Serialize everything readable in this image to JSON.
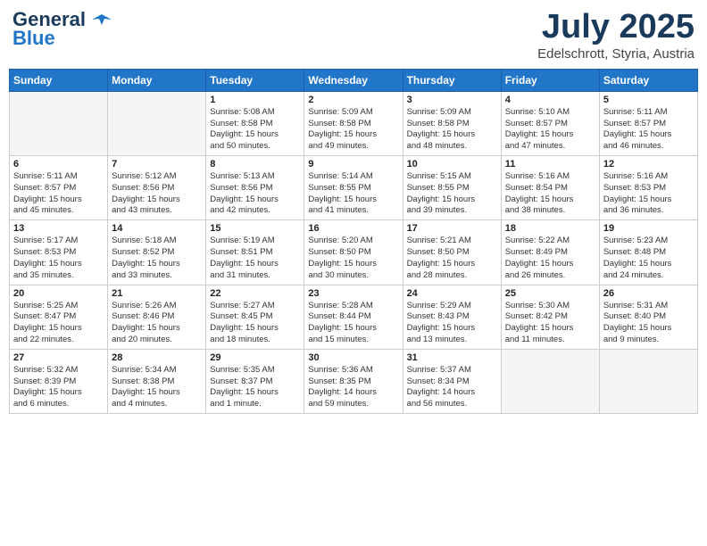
{
  "header": {
    "logo_line1": "General",
    "logo_line2": "Blue",
    "month": "July 2025",
    "location": "Edelschrott, Styria, Austria"
  },
  "days_of_week": [
    "Sunday",
    "Monday",
    "Tuesday",
    "Wednesday",
    "Thursday",
    "Friday",
    "Saturday"
  ],
  "weeks": [
    [
      {
        "day": "",
        "info": ""
      },
      {
        "day": "",
        "info": ""
      },
      {
        "day": "1",
        "info": "Sunrise: 5:08 AM\nSunset: 8:58 PM\nDaylight: 15 hours\nand 50 minutes."
      },
      {
        "day": "2",
        "info": "Sunrise: 5:09 AM\nSunset: 8:58 PM\nDaylight: 15 hours\nand 49 minutes."
      },
      {
        "day": "3",
        "info": "Sunrise: 5:09 AM\nSunset: 8:58 PM\nDaylight: 15 hours\nand 48 minutes."
      },
      {
        "day": "4",
        "info": "Sunrise: 5:10 AM\nSunset: 8:57 PM\nDaylight: 15 hours\nand 47 minutes."
      },
      {
        "day": "5",
        "info": "Sunrise: 5:11 AM\nSunset: 8:57 PM\nDaylight: 15 hours\nand 46 minutes."
      }
    ],
    [
      {
        "day": "6",
        "info": "Sunrise: 5:11 AM\nSunset: 8:57 PM\nDaylight: 15 hours\nand 45 minutes."
      },
      {
        "day": "7",
        "info": "Sunrise: 5:12 AM\nSunset: 8:56 PM\nDaylight: 15 hours\nand 43 minutes."
      },
      {
        "day": "8",
        "info": "Sunrise: 5:13 AM\nSunset: 8:56 PM\nDaylight: 15 hours\nand 42 minutes."
      },
      {
        "day": "9",
        "info": "Sunrise: 5:14 AM\nSunset: 8:55 PM\nDaylight: 15 hours\nand 41 minutes."
      },
      {
        "day": "10",
        "info": "Sunrise: 5:15 AM\nSunset: 8:55 PM\nDaylight: 15 hours\nand 39 minutes."
      },
      {
        "day": "11",
        "info": "Sunrise: 5:16 AM\nSunset: 8:54 PM\nDaylight: 15 hours\nand 38 minutes."
      },
      {
        "day": "12",
        "info": "Sunrise: 5:16 AM\nSunset: 8:53 PM\nDaylight: 15 hours\nand 36 minutes."
      }
    ],
    [
      {
        "day": "13",
        "info": "Sunrise: 5:17 AM\nSunset: 8:53 PM\nDaylight: 15 hours\nand 35 minutes."
      },
      {
        "day": "14",
        "info": "Sunrise: 5:18 AM\nSunset: 8:52 PM\nDaylight: 15 hours\nand 33 minutes."
      },
      {
        "day": "15",
        "info": "Sunrise: 5:19 AM\nSunset: 8:51 PM\nDaylight: 15 hours\nand 31 minutes."
      },
      {
        "day": "16",
        "info": "Sunrise: 5:20 AM\nSunset: 8:50 PM\nDaylight: 15 hours\nand 30 minutes."
      },
      {
        "day": "17",
        "info": "Sunrise: 5:21 AM\nSunset: 8:50 PM\nDaylight: 15 hours\nand 28 minutes."
      },
      {
        "day": "18",
        "info": "Sunrise: 5:22 AM\nSunset: 8:49 PM\nDaylight: 15 hours\nand 26 minutes."
      },
      {
        "day": "19",
        "info": "Sunrise: 5:23 AM\nSunset: 8:48 PM\nDaylight: 15 hours\nand 24 minutes."
      }
    ],
    [
      {
        "day": "20",
        "info": "Sunrise: 5:25 AM\nSunset: 8:47 PM\nDaylight: 15 hours\nand 22 minutes."
      },
      {
        "day": "21",
        "info": "Sunrise: 5:26 AM\nSunset: 8:46 PM\nDaylight: 15 hours\nand 20 minutes."
      },
      {
        "day": "22",
        "info": "Sunrise: 5:27 AM\nSunset: 8:45 PM\nDaylight: 15 hours\nand 18 minutes."
      },
      {
        "day": "23",
        "info": "Sunrise: 5:28 AM\nSunset: 8:44 PM\nDaylight: 15 hours\nand 15 minutes."
      },
      {
        "day": "24",
        "info": "Sunrise: 5:29 AM\nSunset: 8:43 PM\nDaylight: 15 hours\nand 13 minutes."
      },
      {
        "day": "25",
        "info": "Sunrise: 5:30 AM\nSunset: 8:42 PM\nDaylight: 15 hours\nand 11 minutes."
      },
      {
        "day": "26",
        "info": "Sunrise: 5:31 AM\nSunset: 8:40 PM\nDaylight: 15 hours\nand 9 minutes."
      }
    ],
    [
      {
        "day": "27",
        "info": "Sunrise: 5:32 AM\nSunset: 8:39 PM\nDaylight: 15 hours\nand 6 minutes."
      },
      {
        "day": "28",
        "info": "Sunrise: 5:34 AM\nSunset: 8:38 PM\nDaylight: 15 hours\nand 4 minutes."
      },
      {
        "day": "29",
        "info": "Sunrise: 5:35 AM\nSunset: 8:37 PM\nDaylight: 15 hours\nand 1 minute."
      },
      {
        "day": "30",
        "info": "Sunrise: 5:36 AM\nSunset: 8:35 PM\nDaylight: 14 hours\nand 59 minutes."
      },
      {
        "day": "31",
        "info": "Sunrise: 5:37 AM\nSunset: 8:34 PM\nDaylight: 14 hours\nand 56 minutes."
      },
      {
        "day": "",
        "info": ""
      },
      {
        "day": "",
        "info": ""
      }
    ]
  ]
}
